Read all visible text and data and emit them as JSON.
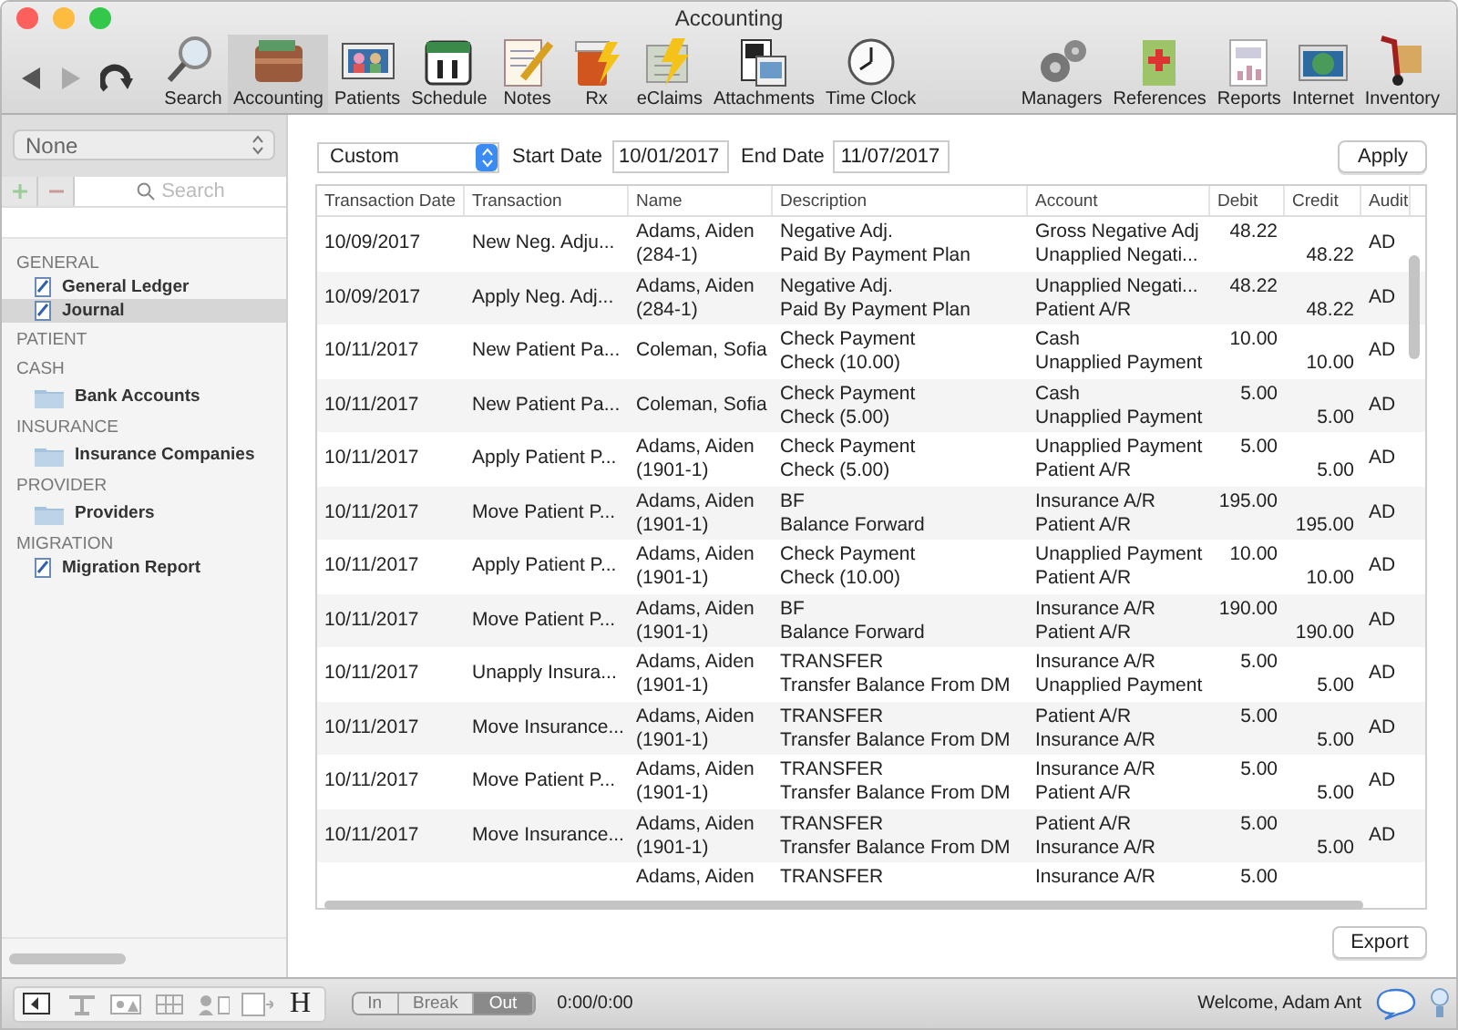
{
  "window": {
    "title": "Accounting"
  },
  "toolbar": {
    "left": [
      {
        "label": "Search",
        "selected": false
      },
      {
        "label": "Accounting",
        "selected": true
      },
      {
        "label": "Patients",
        "selected": false
      },
      {
        "label": "Schedule",
        "selected": false
      },
      {
        "label": "Notes",
        "selected": false
      },
      {
        "label": "Rx",
        "selected": false
      },
      {
        "label": "eClaims",
        "selected": false
      },
      {
        "label": "Attachments",
        "selected": false
      },
      {
        "label": "Time Clock",
        "selected": false
      }
    ],
    "right": [
      {
        "label": "Managers"
      },
      {
        "label": "References"
      },
      {
        "label": "Reports"
      },
      {
        "label": "Internet"
      },
      {
        "label": "Inventory"
      }
    ]
  },
  "sidebar": {
    "filter": "None",
    "search": {
      "placeholder": "Search"
    },
    "sections": [
      {
        "title": "GENERAL",
        "items": [
          {
            "label": "General Ledger",
            "kind": "note",
            "selected": false
          },
          {
            "label": "Journal",
            "kind": "note",
            "selected": true
          }
        ]
      },
      {
        "title": "PATIENT"
      },
      {
        "title": "CASH",
        "items": [
          {
            "label": "Bank Accounts",
            "kind": "folder",
            "selected": false
          }
        ]
      },
      {
        "title": "INSURANCE",
        "items": [
          {
            "label": "Insurance Companies",
            "kind": "folder",
            "selected": false
          }
        ]
      },
      {
        "title": "PROVIDER",
        "items": [
          {
            "label": "Providers",
            "kind": "folder",
            "selected": false
          }
        ]
      },
      {
        "title": "MIGRATION",
        "items": [
          {
            "label": "Migration Report",
            "kind": "note",
            "selected": false
          }
        ]
      }
    ]
  },
  "filter": {
    "range": "Custom",
    "start_label": "Start Date",
    "start_date": "10/01/2017",
    "end_label": "End Date",
    "end_date": "11/07/2017",
    "apply": "Apply"
  },
  "table": {
    "columns": [
      "Transaction Date",
      "Transaction",
      "Name",
      "Description",
      "Account",
      "Debit",
      "Credit",
      "Audit"
    ],
    "rows": [
      {
        "date": "10/09/2017",
        "transaction": "New Neg. Adju...",
        "name": [
          "Adams, Aiden",
          "(284-1)"
        ],
        "description": [
          "Negative Adj.",
          "Paid By Payment Plan"
        ],
        "account": [
          "Gross Negative Adj",
          "Unapplied Negati..."
        ],
        "debit": "48.22",
        "credit": "48.22",
        "audit": "AD"
      },
      {
        "date": "10/09/2017",
        "transaction": "Apply Neg. Adj...",
        "name": [
          "Adams, Aiden",
          "(284-1)"
        ],
        "description": [
          "Negative Adj.",
          "Paid By Payment Plan"
        ],
        "account": [
          "Unapplied Negati...",
          "Patient A/R"
        ],
        "debit": "48.22",
        "credit": "48.22",
        "audit": "AD"
      },
      {
        "date": "10/11/2017",
        "transaction": "New Patient Pa...",
        "name": [
          "Coleman, Sofia"
        ],
        "description": [
          "Check Payment",
          "Check (10.00)"
        ],
        "account": [
          "Cash",
          "Unapplied Payment"
        ],
        "debit": "10.00",
        "credit": "10.00",
        "audit": "AD"
      },
      {
        "date": "10/11/2017",
        "transaction": "New Patient Pa...",
        "name": [
          "Coleman, Sofia"
        ],
        "description": [
          "Check Payment",
          "Check (5.00)"
        ],
        "account": [
          "Cash",
          "Unapplied Payment"
        ],
        "debit": "5.00",
        "credit": "5.00",
        "audit": "AD"
      },
      {
        "date": "10/11/2017",
        "transaction": "Apply Patient P...",
        "name": [
          "Adams, Aiden",
          "(1901-1)"
        ],
        "description": [
          "Check Payment",
          "Check (5.00)"
        ],
        "account": [
          "Unapplied Payment",
          "Patient A/R"
        ],
        "debit": "5.00",
        "credit": "5.00",
        "audit": "AD"
      },
      {
        "date": "10/11/2017",
        "transaction": "Move Patient P...",
        "name": [
          "Adams, Aiden",
          "(1901-1)"
        ],
        "description": [
          "BF",
          "Balance Forward"
        ],
        "account": [
          "Insurance A/R",
          "Patient A/R"
        ],
        "debit": "195.00",
        "credit": "195.00",
        "audit": "AD"
      },
      {
        "date": "10/11/2017",
        "transaction": "Apply Patient P...",
        "name": [
          "Adams, Aiden",
          "(1901-1)"
        ],
        "description": [
          "Check Payment",
          "Check (10.00)"
        ],
        "account": [
          "Unapplied Payment",
          "Patient A/R"
        ],
        "debit": "10.00",
        "credit": "10.00",
        "audit": "AD"
      },
      {
        "date": "10/11/2017",
        "transaction": "Move Patient P...",
        "name": [
          "Adams, Aiden",
          "(1901-1)"
        ],
        "description": [
          "BF",
          "Balance Forward"
        ],
        "account": [
          "Insurance A/R",
          "Patient A/R"
        ],
        "debit": "190.00",
        "credit": "190.00",
        "audit": "AD"
      },
      {
        "date": "10/11/2017",
        "transaction": "Unapply Insura...",
        "name": [
          "Adams, Aiden",
          "(1901-1)"
        ],
        "description": [
          "TRANSFER",
          "Transfer Balance From DM"
        ],
        "account": [
          "Insurance A/R",
          "Unapplied Payment"
        ],
        "debit": "5.00",
        "credit": "5.00",
        "audit": "AD"
      },
      {
        "date": "10/11/2017",
        "transaction": "Move Insurance...",
        "name": [
          "Adams, Aiden",
          "(1901-1)"
        ],
        "description": [
          "TRANSFER",
          "Transfer Balance From DM"
        ],
        "account": [
          "Patient A/R",
          "Insurance A/R"
        ],
        "debit": "5.00",
        "credit": "5.00",
        "audit": "AD"
      },
      {
        "date": "10/11/2017",
        "transaction": "Move Patient P...",
        "name": [
          "Adams, Aiden",
          "(1901-1)"
        ],
        "description": [
          "TRANSFER",
          "Transfer Balance From DM"
        ],
        "account": [
          "Insurance A/R",
          "Patient A/R"
        ],
        "debit": "5.00",
        "credit": "5.00",
        "audit": "AD"
      },
      {
        "date": "10/11/2017",
        "transaction": "Move Insurance...",
        "name": [
          "Adams, Aiden",
          "(1901-1)"
        ],
        "description": [
          "TRANSFER",
          "Transfer Balance From DM"
        ],
        "account": [
          "Patient A/R",
          "Insurance A/R"
        ],
        "debit": "5.00",
        "credit": "5.00",
        "audit": "AD"
      },
      {
        "name": [
          "Adams, Aiden"
        ],
        "description": [
          "TRANSFER"
        ],
        "account": [
          "Insurance A/R"
        ],
        "debit": "5.00"
      }
    ]
  },
  "export": "Export",
  "status_bar": {
    "h_key": "H",
    "clock": [
      {
        "label": "In",
        "selected": false
      },
      {
        "label": "Break",
        "selected": false
      },
      {
        "label": "Out",
        "selected": true
      }
    ],
    "time": "0:00/0:00",
    "welcome": "Welcome, Adam Ant"
  }
}
